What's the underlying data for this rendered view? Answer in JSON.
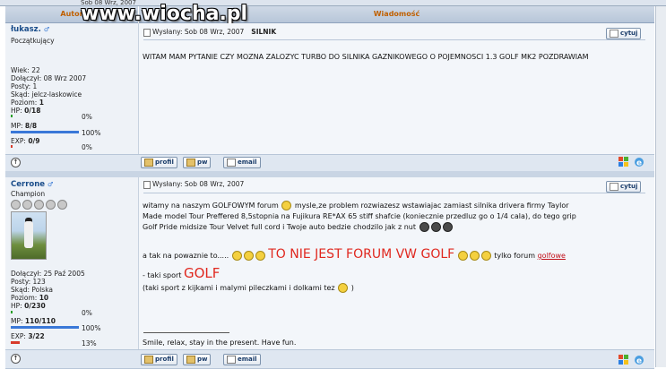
{
  "site": {
    "logo": "www.wiocha.pl"
  },
  "top_date": "Sob 08 Wrz, 2007",
  "headers": {
    "author": "Autor",
    "message": "Wiadomość"
  },
  "posts": [
    {
      "username": "łukasz.",
      "rank": "Początkujący",
      "stats": {
        "age": "Wiek: 22",
        "joined": "Dołączył: 08 Wrz 2007",
        "posts": "Posty: 1",
        "from": "Skąd: jelcz-laskowice",
        "level_label": "Poziom:",
        "level": "1",
        "hp_label": "HP:",
        "hp": "0/18",
        "hp_pct": "0%",
        "mp_label": "MP:",
        "mp": "8/8",
        "mp_pct": "100%",
        "exp_label": "EXP:",
        "exp": "0/9",
        "exp_pct": "0%"
      },
      "header": "Wysłany: Sob 08 Wrz, 2007",
      "subject": "SILNIK",
      "body": "WITAM MAM PYTANIE CZY MOZNA ZALOZYC TURBO DO SILNIKA GAZNIKOWEGO O POJEMNOSCI 1.3 GOLF MK2 POZDRAWIAM",
      "quote_label": "cytuj",
      "buttons": {
        "profile": "profil",
        "pm": "pw",
        "email": "email"
      }
    },
    {
      "username": "Cerrone",
      "rank": "Champion",
      "stats": {
        "joined": "Dołączył: 25 Paź 2005",
        "posts": "Posty: 123",
        "from": "Skąd: Polska",
        "level_label": "Poziom:",
        "level": "10",
        "hp_label": "HP:",
        "hp": "0/230",
        "hp_pct": "0%",
        "mp_label": "MP:",
        "mp": "110/110",
        "mp_pct": "100%",
        "exp_label": "EXP:",
        "exp": "3/22",
        "exp_pct": "13%"
      },
      "header": "Wysłany: Sob 08 Wrz, 2007",
      "body_1": "witamy na naszym GOLFOWYM forum",
      "body_1b": "mysle,ze problem rozwiazesz wstawiajac zamiast silnika drivera firmy Taylor",
      "body_2": "Made model Tour Preffered 8,5stopnia na Fujikura RE*AX 65 stiff shafcie (koniecznie przedluz go o 1/4 cala), do tego grip",
      "body_3": "Golf Pride midsize Tour Velvet full cord i Twoje auto bedzie chodzilo jak z nut",
      "body_4a": "a tak na powaznie to.....",
      "body_4big": "TO NIE JEST FORUM VW GOLF",
      "body_4c": "tylko forum",
      "body_4link": "golfowe",
      "body_5a": "- taki sport",
      "body_5big": "GOLF",
      "body_6": "(taki sport z kijkami i malymi pileczkami i dolkami tez",
      "body_6end": ")",
      "signature": "Smile, relax, stay in the present. Have fun.",
      "quote_label": "cytuj",
      "buttons": {
        "profile": "profil",
        "pm": "pw",
        "email": "email"
      }
    }
  ],
  "colors": {
    "hp_bar": "#2aa02a",
    "mp_bar": "#3a78d8",
    "exp_bar": "#d83a2a",
    "big_red": "#e0281f"
  }
}
